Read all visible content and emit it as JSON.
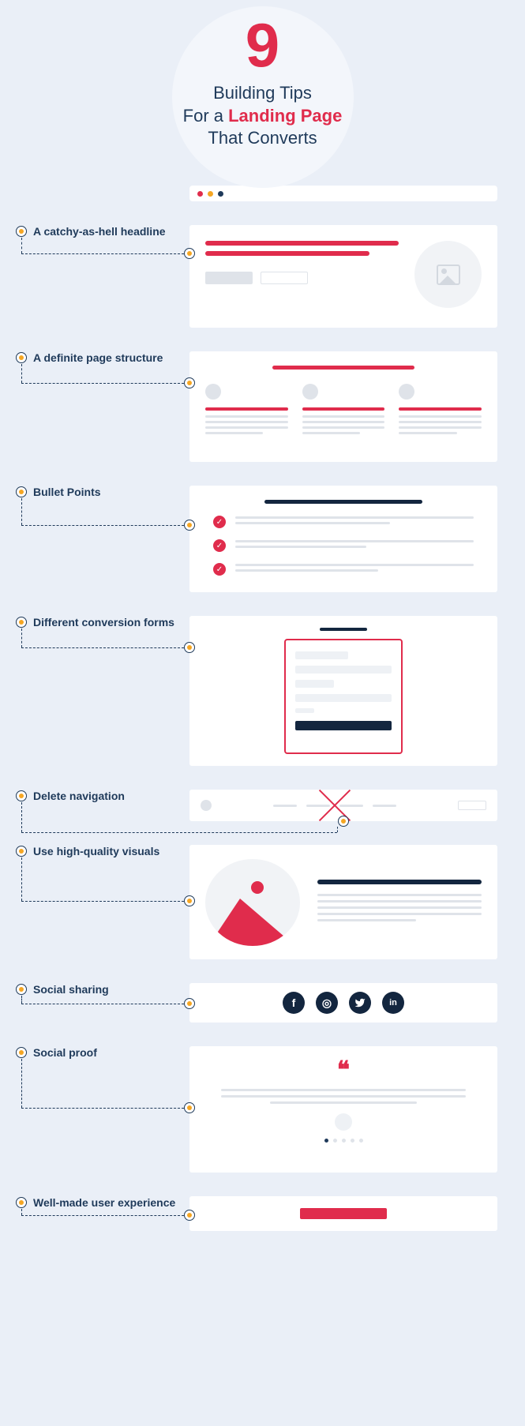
{
  "header": {
    "number": "9",
    "line1": "Building Tips",
    "line2_a": "For a ",
    "line2_b": "Landing Page",
    "line3": "That Converts"
  },
  "tips": {
    "t1": "A catchy-as-hell headline",
    "t2": "A definite page structure",
    "t3": "Bullet Points",
    "t4": "Different conversion forms",
    "t5": "Delete navigation",
    "t6": "Use high-quality visuals",
    "t7": "Social sharing",
    "t8": "Social proof",
    "t9": "Well-made user experience"
  },
  "social": {
    "fb": "f",
    "ig": "◎",
    "tw": "𝕏",
    "in": "in"
  },
  "quote_marks": "❝"
}
